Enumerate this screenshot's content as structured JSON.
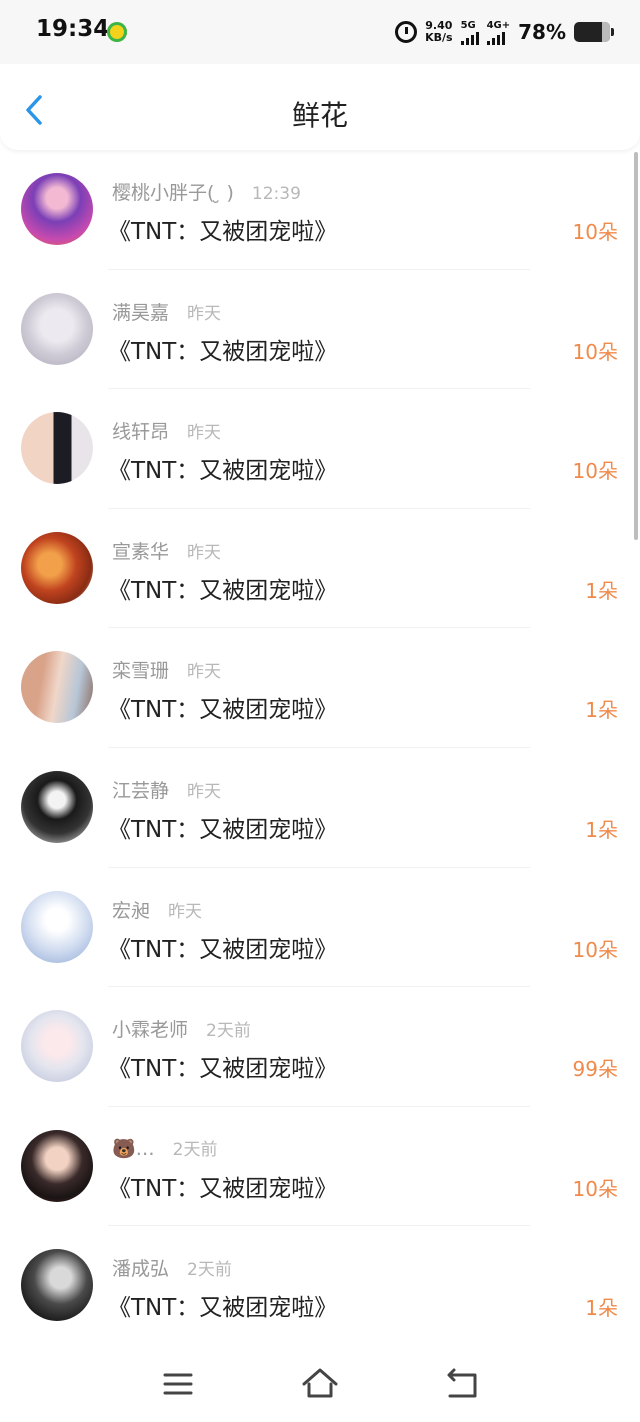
{
  "status_bar": {
    "time": "19:34",
    "speed_value": "9.40",
    "speed_unit": "KB/s",
    "signal1_label": "5G",
    "signal2_label": "4G+",
    "battery": "78%",
    "battery_level": 0.78
  },
  "header": {
    "title": "鲜花"
  },
  "colors": {
    "accent": "#2b96e8",
    "count": "#f08a4b"
  },
  "items": [
    {
      "name": "樱桃小胖子( ̮ )",
      "time": "12:39",
      "gift": "《TNT：又被团宠啦》",
      "count": "10朵"
    },
    {
      "name": "满昊嘉",
      "time": "昨天",
      "gift": "《TNT：又被团宠啦》",
      "count": "10朵"
    },
    {
      "name": "线轩昂",
      "time": "昨天",
      "gift": "《TNT：又被团宠啦》",
      "count": "10朵"
    },
    {
      "name": "宣素华",
      "time": "昨天",
      "gift": "《TNT：又被团宠啦》",
      "count": "1朵"
    },
    {
      "name": "栾雪珊",
      "time": "昨天",
      "gift": "《TNT：又被团宠啦》",
      "count": "1朵"
    },
    {
      "name": "江芸静",
      "time": "昨天",
      "gift": "《TNT：又被团宠啦》",
      "count": "1朵"
    },
    {
      "name": "宏昶",
      "time": "昨天",
      "gift": "《TNT：又被团宠啦》",
      "count": "10朵"
    },
    {
      "name": "小霖老师",
      "time": "2天前",
      "gift": "《TNT：又被团宠啦》",
      "count": "99朵"
    },
    {
      "name": "🐻…",
      "time": "2天前",
      "gift": "《TNT：又被团宠啦》",
      "count": "10朵"
    },
    {
      "name": "潘成弘",
      "time": "2天前",
      "gift": "《TNT：又被团宠啦》",
      "count": "1朵"
    }
  ],
  "nav": {
    "menu_icon": "menu-icon",
    "home_icon": "home-icon",
    "back_icon": "return-icon"
  }
}
